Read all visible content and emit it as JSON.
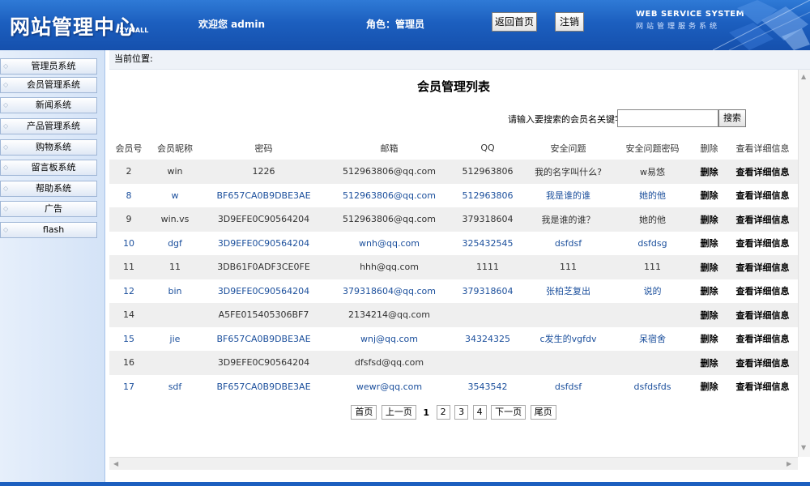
{
  "header": {
    "logo": "网站管理中心",
    "logo_sub": "XYMALL",
    "welcome": "欢迎您   admin",
    "role": "角色：管理员",
    "home_button": "返回首页",
    "logout_button": "注销",
    "system_title": "WEB SERVICE SYSTEM",
    "system_subtitle": "网站管理服务系统"
  },
  "sidebar": {
    "items": [
      {
        "label": "管理员系统"
      },
      {
        "label": "会员管理系统"
      },
      {
        "label": "新闻系统"
      },
      {
        "label": "产品管理系统"
      },
      {
        "label": "购物系统"
      },
      {
        "label": "留言板系统"
      },
      {
        "label": "帮助系统"
      },
      {
        "label": "广告"
      },
      {
        "label": "flash"
      }
    ]
  },
  "breadcrumb": "当前位置:",
  "main": {
    "title": "会员管理列表",
    "search_label": "请输入要搜索的会员名关键字",
    "search_value": "",
    "search_button": "搜索"
  },
  "table": {
    "headers": [
      "会员号",
      "会员昵称",
      "密码",
      "邮箱",
      "QQ",
      "安全问题",
      "安全问题密码",
      "删除",
      "查看详细信息"
    ],
    "rows": [
      {
        "id": "2",
        "nick": "win",
        "pwd": "1226",
        "email": "512963806@qq.com",
        "qq": "512963806",
        "question": "我的名字叫什么?",
        "answer": "w易悠",
        "del": "删除",
        "detail": "查看详细信息"
      },
      {
        "id": "8",
        "nick": "w",
        "pwd": "BF657CA0B9DBE3AE",
        "email": "512963806@qq.com",
        "qq": "512963806",
        "question": "我是谁的谁",
        "answer": "她的他",
        "del": "删除",
        "detail": "查看详细信息"
      },
      {
        "id": "9",
        "nick": "win.vs",
        "pwd": "3D9EFE0C90564204",
        "email": "512963806@qq.com",
        "qq": "379318604",
        "question": "我是谁的谁？",
        "answer": "她的他",
        "del": "删除",
        "detail": "查看详细信息"
      },
      {
        "id": "10",
        "nick": "dgf",
        "pwd": "3D9EFE0C90564204",
        "email": "wnh@qq.com",
        "qq": "325432545",
        "question": "dsfdsf",
        "answer": "dsfdsg",
        "del": "删除",
        "detail": "查看详细信息"
      },
      {
        "id": "11",
        "nick": "11",
        "pwd": "3DB61F0ADF3CE0FE",
        "email": "hhh@qq.com",
        "qq": "1111",
        "question": "111",
        "answer": "111",
        "del": "删除",
        "detail": "查看详细信息"
      },
      {
        "id": "12",
        "nick": "bin",
        "pwd": "3D9EFE0C90564204",
        "email": "379318604@qq.com",
        "qq": "379318604",
        "question": "张柏芝复出",
        "answer": "说的",
        "del": "删除",
        "detail": "查看详细信息"
      },
      {
        "id": "14",
        "nick": "",
        "pwd": "A5FE015405306BF7",
        "email": "2134214@qq.com",
        "qq": "",
        "question": "",
        "answer": "",
        "del": "删除",
        "detail": "查看详细信息"
      },
      {
        "id": "15",
        "nick": "jie",
        "pwd": "BF657CA0B9DBE3AE",
        "email": "wnj@qq.com",
        "qq": "34324325",
        "question": "c发生的vgfdv",
        "answer": "呆宿舍",
        "del": "删除",
        "detail": "查看详细信息"
      },
      {
        "id": "16",
        "nick": "",
        "pwd": "3D9EFE0C90564204",
        "email": "dfsfsd@qq.com",
        "qq": "",
        "question": "",
        "answer": "",
        "del": "删除",
        "detail": "查看详细信息"
      },
      {
        "id": "17",
        "nick": "sdf",
        "pwd": "BF657CA0B9DBE3AE",
        "email": "wewr@qq.com",
        "qq": "3543542",
        "question": "dsfdsf",
        "answer": "dsfdsfds",
        "del": "删除",
        "detail": "查看详细信息"
      }
    ]
  },
  "pager": {
    "first": "首页",
    "prev": "上一页",
    "current": "1",
    "pages": [
      "2",
      "3",
      "4"
    ],
    "next": "下一页",
    "last": "尾页"
  }
}
